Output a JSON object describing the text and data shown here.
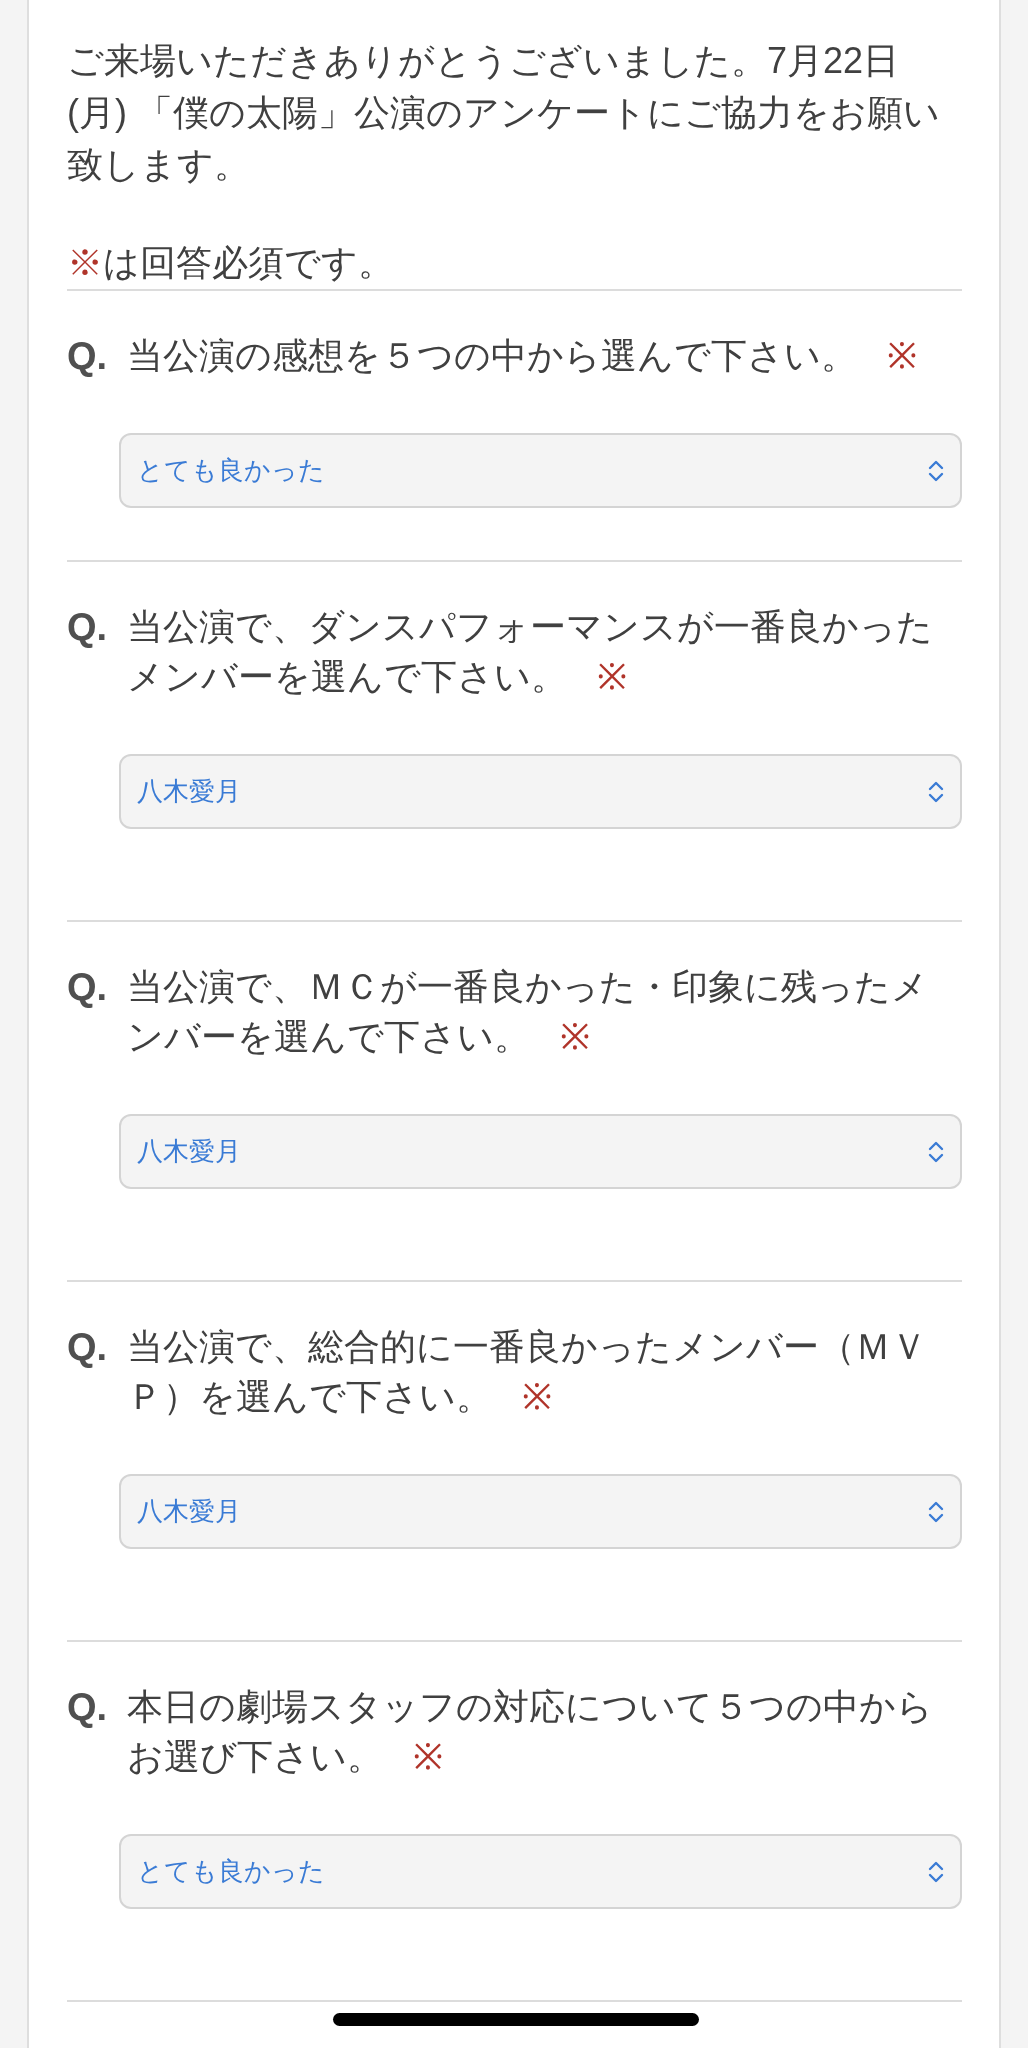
{
  "intro": {
    "text": "ご来場いただきありがとうございました。7月22日(月) 「僕の太陽」公演のアンケートにご協力をお願い致します。"
  },
  "note": {
    "mark": "※",
    "text": "は回答必須です。"
  },
  "questions": [
    {
      "label": "Q.",
      "text": "当公演の感想を５つの中から選んで下さい。",
      "required_mark": "※",
      "answer": "とても良かった"
    },
    {
      "label": "Q.",
      "text": "当公演で、ダンスパフォーマンスが一番良かったメンバーを選んで下さい。",
      "required_mark": "※",
      "answer": "八木愛月"
    },
    {
      "label": "Q.",
      "text": "当公演で、ＭＣが一番良かった・印象に残ったメンバーを選んで下さい。",
      "required_mark": "※",
      "answer": "八木愛月"
    },
    {
      "label": "Q.",
      "text": "当公演で、総合的に一番良かったメンバー（ＭＶＰ）を選んで下さい。",
      "required_mark": "※",
      "answer": "八木愛月"
    },
    {
      "label": "Q.",
      "text": "本日の劇場スタッフの対応について５つの中からお選び下さい。",
      "required_mark": "※",
      "answer": "とても良かった"
    }
  ]
}
